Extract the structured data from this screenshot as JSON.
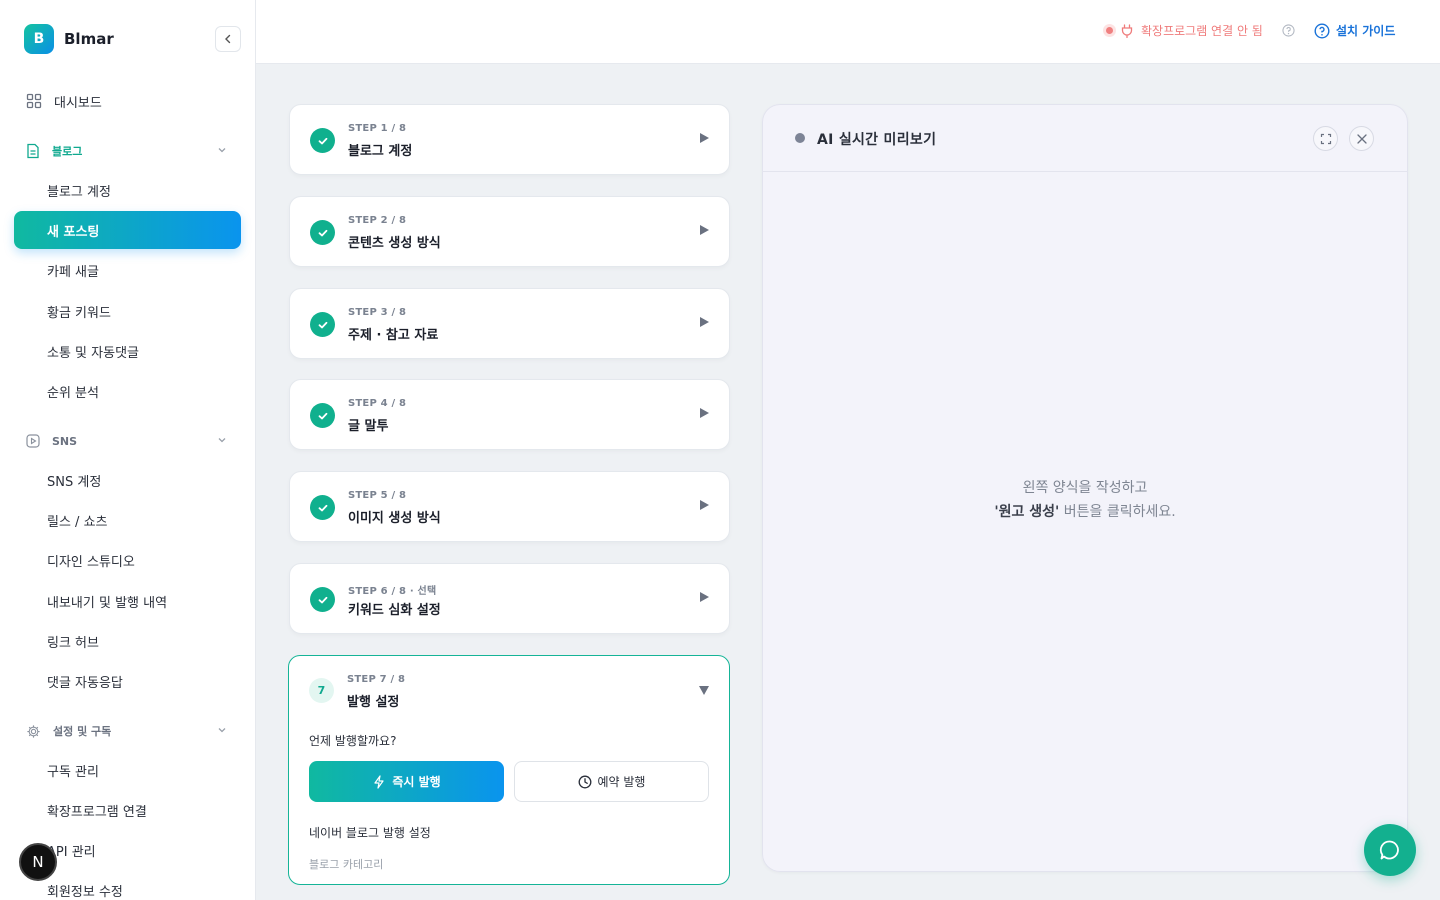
{
  "brand": {
    "logo_letter": "B",
    "name": "Blmar"
  },
  "sidebar": {
    "dashboard": "대시보드",
    "sections": [
      {
        "label": "블로그",
        "items": [
          "블로그 계정",
          "새 포스팅",
          "카페 새글",
          "황금 키워드",
          "소통 및 자동댓글",
          "순위 분석"
        ]
      },
      {
        "label": "SNS",
        "items": [
          "SNS 계정",
          "릴스 / 쇼츠",
          "디자인 스튜디오",
          "내보내기 및 발행 내역",
          "링크 허브",
          "댓글 자동응답"
        ]
      },
      {
        "label": "설정 및 구독",
        "items": [
          "구독 관리",
          "확장프로그램 연결",
          "API 관리",
          "회원정보 수정"
        ]
      }
    ],
    "active_item": "새 포스팅",
    "avatar_letter": "N"
  },
  "header": {
    "extension_status": "확장프로그램 연결 안 됨",
    "guide_label": "설치 가이드",
    "colors": {
      "status": "#ef7b7b",
      "guide": "#1a73d9"
    }
  },
  "steps": [
    {
      "meta": "STEP 1 / 8",
      "title": "블로그 계정",
      "done": true
    },
    {
      "meta": "STEP 2 / 8",
      "title": "콘텐츠 생성 방식",
      "done": true
    },
    {
      "meta": "STEP 3 / 8",
      "title": "주제 · 참고 자료",
      "done": true
    },
    {
      "meta": "STEP 4 / 8",
      "title": "글 말투",
      "done": true
    },
    {
      "meta": "STEP 5 / 8",
      "title": "이미지 생성 방식",
      "done": true
    },
    {
      "meta": "STEP 6 / 8 · 선택",
      "title": "키워드 심화 설정",
      "done": true
    }
  ],
  "open_step": {
    "number": "7",
    "meta": "STEP 7 / 8",
    "title": "발행 설정",
    "question": "언제 발행할까요?",
    "publish_now": "즉시 발행",
    "publish_scheduled": "예약 발행",
    "naver_settings": "네이버 블로그 발행 설정",
    "category_label": "블로그 카테고리"
  },
  "preview": {
    "title": "AI 실시간 미리보기",
    "empty_line1": "왼쪽 양식을 작성하고",
    "empty_highlight": "'원고 생성'",
    "empty_line2_rest": " 버튼을 클릭하세요."
  },
  "accent_color": "#10b08e"
}
